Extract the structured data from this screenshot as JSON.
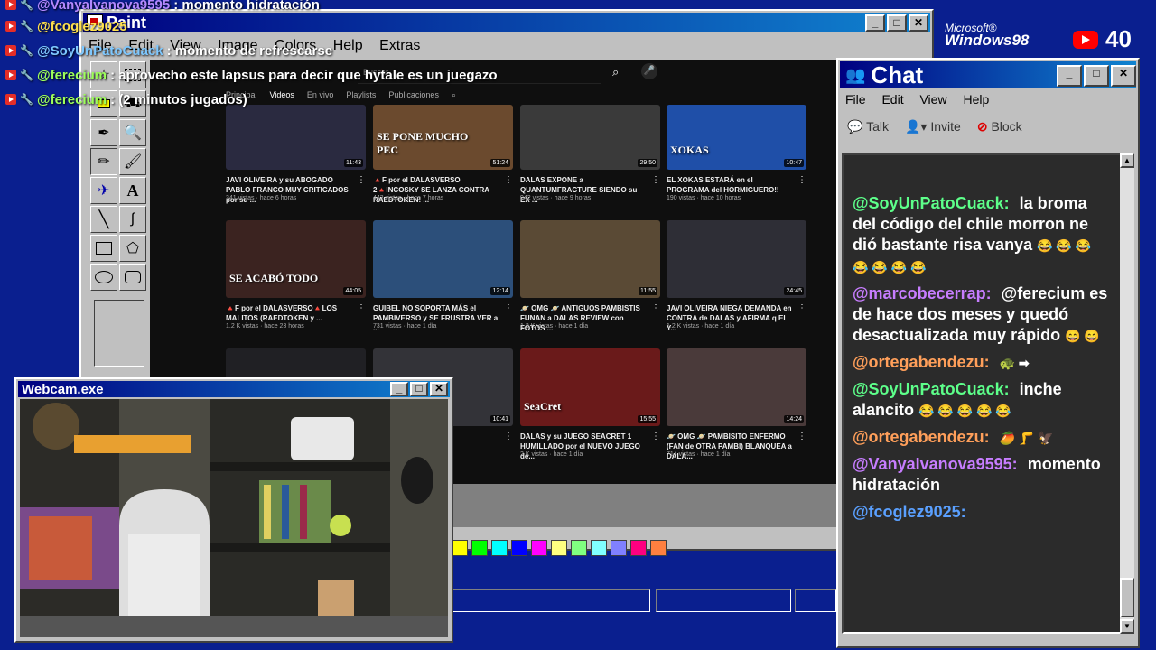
{
  "overlay_chat": [
    {
      "user": "@VanyaIvanova9595",
      "text": ": momento hidratación",
      "color": "#b388ff"
    },
    {
      "user": "@fcoglez9025",
      "text": "",
      "color": "#ffe14d"
    },
    {
      "user": "@SoyUnPatoCuack",
      "text": ": momento de refrescarse",
      "color": "#7ec8ff"
    },
    {
      "user": "@ferecium",
      "text": ": aprovecho este lapsus para decir que hytale es un juegazo",
      "color": "#9dff5a"
    },
    {
      "user": "@ferecium",
      "text": ": (2 minutos jugados)",
      "color": "#9dff5a"
    }
  ],
  "paint": {
    "title": "Paint",
    "menu": [
      "File",
      "Edit",
      "View",
      "Image",
      "Colors",
      "Help",
      "Extras"
    ],
    "palette": [
      "#ffff00",
      "#00ff00",
      "#00ffff",
      "#0000ff",
      "#ff00ff",
      "#ffff80",
      "#80ff80",
      "#80ffff",
      "#8080ff",
      "#ff0080",
      "#ff8040"
    ],
    "tools": [
      "select-star",
      "select-rect",
      "eraser",
      "fill",
      "picker",
      "magnifier",
      "pencil",
      "brush",
      "airbrush",
      "text",
      "line",
      "curve",
      "rectangle",
      "polygon",
      "ellipse",
      "rounded-rect"
    ]
  },
  "youtube": {
    "search_placeholder": "Buscar",
    "tabs": [
      "Principal",
      "Videos",
      "En vivo",
      "Playlists",
      "Publicaciones"
    ],
    "active_tab": "Videos",
    "videos": [
      {
        "title": "JAVI OLIVEIRA y su ABOGADO PABLO FRANCO MUY CRITICADOS por su ...",
        "meta": "341 vistas · hace 6 horas",
        "duration": "11:43",
        "thumb_text": "",
        "color": "#2a2a40"
      },
      {
        "title": "🔺F por el DALASVERSO 2🔺INCOSKY SE LANZA CONTRA RAEDTOKEN! ...",
        "meta": "443 vistas · hace 7 horas",
        "duration": "51:24",
        "thumb_text": "SE PONE MUCHO PEC",
        "color": "#6b4a2e"
      },
      {
        "title": "DALAS EXPONE a QUANTUMFRACTURE SIENDO su EX ...",
        "meta": "942 vistas · hace 9 horas",
        "duration": "29:50",
        "thumb_text": "",
        "color": "#3a3a3a"
      },
      {
        "title": "EL XOKAS ESTARÁ en el PROGRAMA del HORMIGUERO!!",
        "meta": "190 vistas · hace 10 horas",
        "duration": "10:47",
        "thumb_text": "XOKAS",
        "color": "#1f4fa8"
      },
      {
        "title": "🔺F por el DALASVERSO🔺LOS MALITOS (RAEDTOKEN y ...",
        "meta": "1.2 K vistas · hace 23 horas",
        "duration": "44:05",
        "thumb_text": "SE ACABÓ TODO",
        "color": "#3b2320"
      },
      {
        "title": "GUIBEL NO SOPORTA MÁS el PAMBIVERSO y SE FRUSTRA VER a ...",
        "meta": "731 vistas · hace 1 día",
        "duration": "12:14",
        "thumb_text": "",
        "color": "#2c4f7a"
      },
      {
        "title": "🪐 OMG 🪐 ANTIGUOS PAMBISTIS FUNAN a DALAS REVIEW con FOTOS ...",
        "meta": "1.3 K vistas · hace 1 día",
        "duration": "11:55",
        "thumb_text": "",
        "color": "#5a4a35"
      },
      {
        "title": "JAVI OLIVEIRA NIEGA DEMANDA en CONTRA de DALAS y AFIRMA q EL Y...",
        "meta": "1.2 K vistas · hace 1 día",
        "duration": "24:45",
        "thumb_text": "",
        "color": "#2e2e36"
      },
      {
        "title": "",
        "meta": "",
        "duration": "",
        "thumb_text": "",
        "color": "#202024"
      },
      {
        "title": "LAS REVIEW UEVA ...",
        "meta": "",
        "duration": "10:41",
        "thumb_text": "",
        "color": "#333338"
      },
      {
        "title": "DALAS y su JUEGO SEACRET 1 HUMILLADO por el NUEVO JUEGO de...",
        "meta": "2 K vistas · hace 1 día",
        "duration": "15:55",
        "thumb_text": "SeaCret",
        "color": "#6a1a1a"
      },
      {
        "title": "🪐 OMG 🪐 PAMBISITO ENFERMO (FAN de OTRA PAMBI) BLANQUEA a DALA...",
        "meta": "714 vistas · hace 1 día",
        "duration": "14:24",
        "thumb_text": "",
        "color": "#4a3a3a"
      }
    ]
  },
  "webcam": {
    "title": "Webcam.exe"
  },
  "win98_logo": {
    "line1": "Microsoft®",
    "line2": "Windows98"
  },
  "viewers": {
    "count": "40"
  },
  "chat": {
    "title": "Chat",
    "menu": [
      "File",
      "Edit",
      "View",
      "Help"
    ],
    "toolbar": {
      "talk": "Talk",
      "invite": "Invite",
      "block": "Block"
    },
    "messages": [
      {
        "user": "@SoyUnPatoCuack:",
        "text": "la broma del código del chile morron ne dió bastante risa vanya",
        "emoji": "😂 😂 😂 😂 😂 😂 😂",
        "color": "#5dff8a"
      },
      {
        "user": "@marcobecerrap:",
        "text": "@ferecium es de hace dos meses y quedó desactualizada muy rápido",
        "emoji": "😄 😄",
        "color": "#c77dff"
      },
      {
        "user": "@ortegabendezu:",
        "text": "",
        "emoji": "🐢 ➡",
        "color": "#ff9f5a"
      },
      {
        "user": "@SoyUnPatoCuack:",
        "text": "inche alancito",
        "emoji": "😂 😂 😂 😂 😂",
        "color": "#5dff8a"
      },
      {
        "user": "@ortegabendezu:",
        "text": "",
        "emoji": "🥭 🦵 🦅",
        "color": "#ff9f5a"
      },
      {
        "user": "@VanyaIvanova9595:",
        "text": "momento hidratación",
        "emoji": "",
        "color": "#c77dff"
      },
      {
        "user": "@fcoglez9025:",
        "text": "",
        "emoji": "",
        "color": "#5aa0ff"
      }
    ]
  }
}
